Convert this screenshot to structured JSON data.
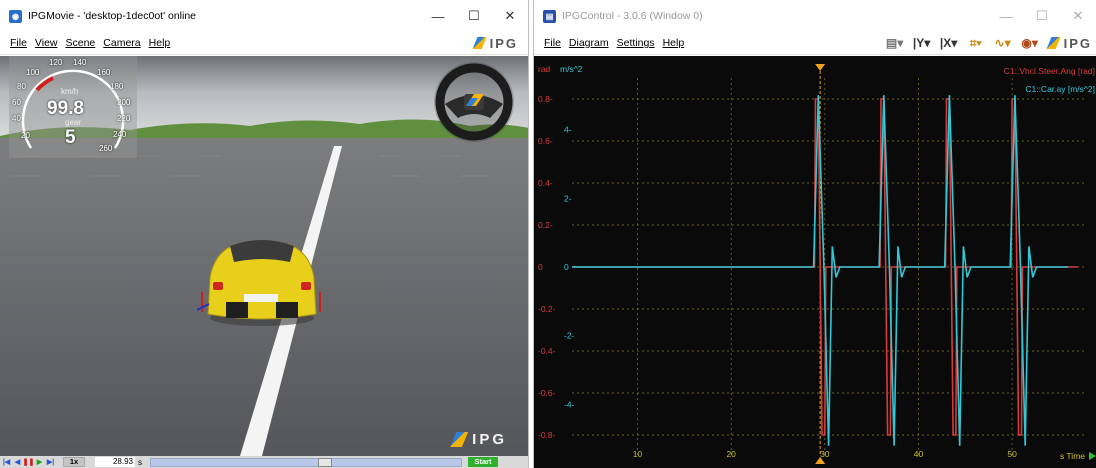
{
  "left_window": {
    "title": "IPGMovie - 'desktop-1dec0ot' online",
    "menu": [
      "File",
      "View",
      "Scene",
      "Camera",
      "Help"
    ],
    "logo_text": "IPG",
    "hud": {
      "speed": "99.8",
      "speed_unit": "km/h",
      "gear_label": "gear",
      "gear": "5",
      "ticks": [
        "100",
        "120",
        "140",
        "160",
        "180",
        "200",
        "220",
        "240",
        "260",
        "80",
        "60",
        "40",
        "20"
      ]
    },
    "scene_logo": "IPG",
    "playback": {
      "speed_label": "1x",
      "time_value": "28.93",
      "time_unit": "s",
      "start_label": "Start",
      "progress": 0.56
    }
  },
  "right_window": {
    "title": "IPGControl - 3.0.6 (Window 0)",
    "menu": [
      "File",
      "Diagram",
      "Settings",
      "Help"
    ],
    "logo_text": "IPG",
    "toolbar_icons": [
      "database-icon",
      "y-axis-icon",
      "x-axis-icon",
      "marker-icon",
      "signal-icon",
      "camera-icon"
    ]
  },
  "colors": {
    "steer": "#d63c3c",
    "ay": "#30c8d6",
    "cursor": "#f0a020",
    "grid": "#8a7a30",
    "background": "#0a0a0a"
  },
  "chart_data": {
    "type": "line",
    "xlabel": "s Time",
    "ylabel_left": "rad",
    "ylabel_right": "m/s^2",
    "xlim": [
      3,
      58
    ],
    "ylim_left": [
      -0.9,
      0.9
    ],
    "ylim_right": [
      -5.5,
      5.5
    ],
    "x_ticks": [
      "10",
      "20",
      "30",
      "40",
      "50"
    ],
    "y_ticks_left": [
      "0.8-",
      "0.6-",
      "0.4-",
      "0.2-",
      "0",
      "-0.2-",
      "-0.4-",
      "-0.6-",
      "-0.8-"
    ],
    "y_ticks_right": [
      "4-",
      "2-",
      "0",
      "-2-",
      "-4-"
    ],
    "cursor_x": 29.5,
    "series": [
      {
        "name": "C1::Vhcl.Steer.Ang [rad]",
        "axis": "left",
        "x": [
          3,
          28.9,
          29.0,
          29.3,
          29.7,
          30.0,
          30.1,
          57,
          35.9,
          36.0,
          36.3,
          36.7,
          37.0,
          37.1,
          42.9,
          43.0,
          43.3,
          43.7,
          44.0,
          44.1,
          49.9,
          50.0,
          50.3,
          50.7,
          51.0,
          51.1
        ],
        "values": [
          0,
          0,
          0.8,
          0.8,
          -0.8,
          -0.8,
          0,
          0,
          0,
          0.8,
          0.8,
          -0.8,
          -0.8,
          0,
          0,
          0.8,
          0.8,
          -0.8,
          -0.8,
          0,
          0,
          0.8,
          0.8,
          -0.8,
          -0.8,
          0
        ]
      },
      {
        "name": "C1::Car.ay [m/s^2]",
        "axis": "right",
        "x": [
          3,
          28.8,
          29.3,
          29.9,
          30.4,
          30.8,
          31.2,
          31.6,
          35.8,
          36.3,
          36.9,
          37.4,
          37.8,
          38.2,
          38.6,
          42.8,
          43.3,
          43.9,
          44.4,
          44.8,
          45.2,
          45.6,
          49.8,
          50.3,
          50.9,
          51.4,
          51.8,
          52.2,
          52.6,
          56
        ],
        "values": [
          0,
          0,
          5.0,
          0,
          -5.2,
          0.6,
          -0.3,
          0,
          0,
          5.0,
          0,
          -5.2,
          0.6,
          -0.3,
          0,
          0,
          5.0,
          0,
          -5.2,
          0.6,
          -0.3,
          0,
          0,
          5.0,
          0,
          -5.2,
          0.6,
          -0.3,
          0,
          0
        ]
      }
    ]
  }
}
